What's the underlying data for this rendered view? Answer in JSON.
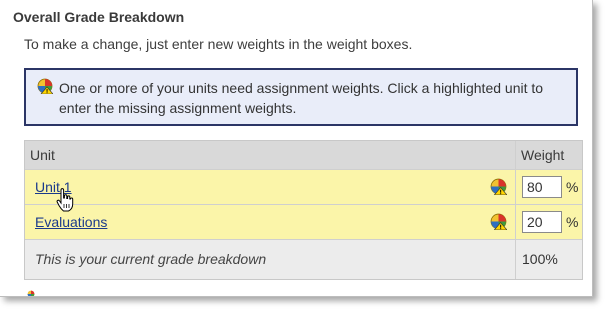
{
  "header": {
    "title": "Overall Grade Breakdown"
  },
  "instructions": "To make a change, just enter new weights in the weight boxes.",
  "alert": {
    "icon": "pie-chart-warning-icon",
    "message": "One or more of your units need assignment weights. Click a highlighted unit to enter the missing assignment weights."
  },
  "table": {
    "columns": {
      "unit": "Unit",
      "weight": "Weight"
    },
    "rows": [
      {
        "name": "Unit 1",
        "weight": "80",
        "suffix": "%",
        "icon": "pie-chart-warning-icon"
      },
      {
        "name": "Evaluations",
        "weight": "20",
        "suffix": "%",
        "icon": "pie-chart-warning-icon"
      }
    ],
    "footer": {
      "label": "This is your current grade breakdown",
      "total": "100%"
    }
  },
  "colors": {
    "highlight_row": "#fbf5a9",
    "alert_bg": "#e9edf9",
    "alert_border": "#2b3566",
    "link": "#1a3a8c"
  }
}
